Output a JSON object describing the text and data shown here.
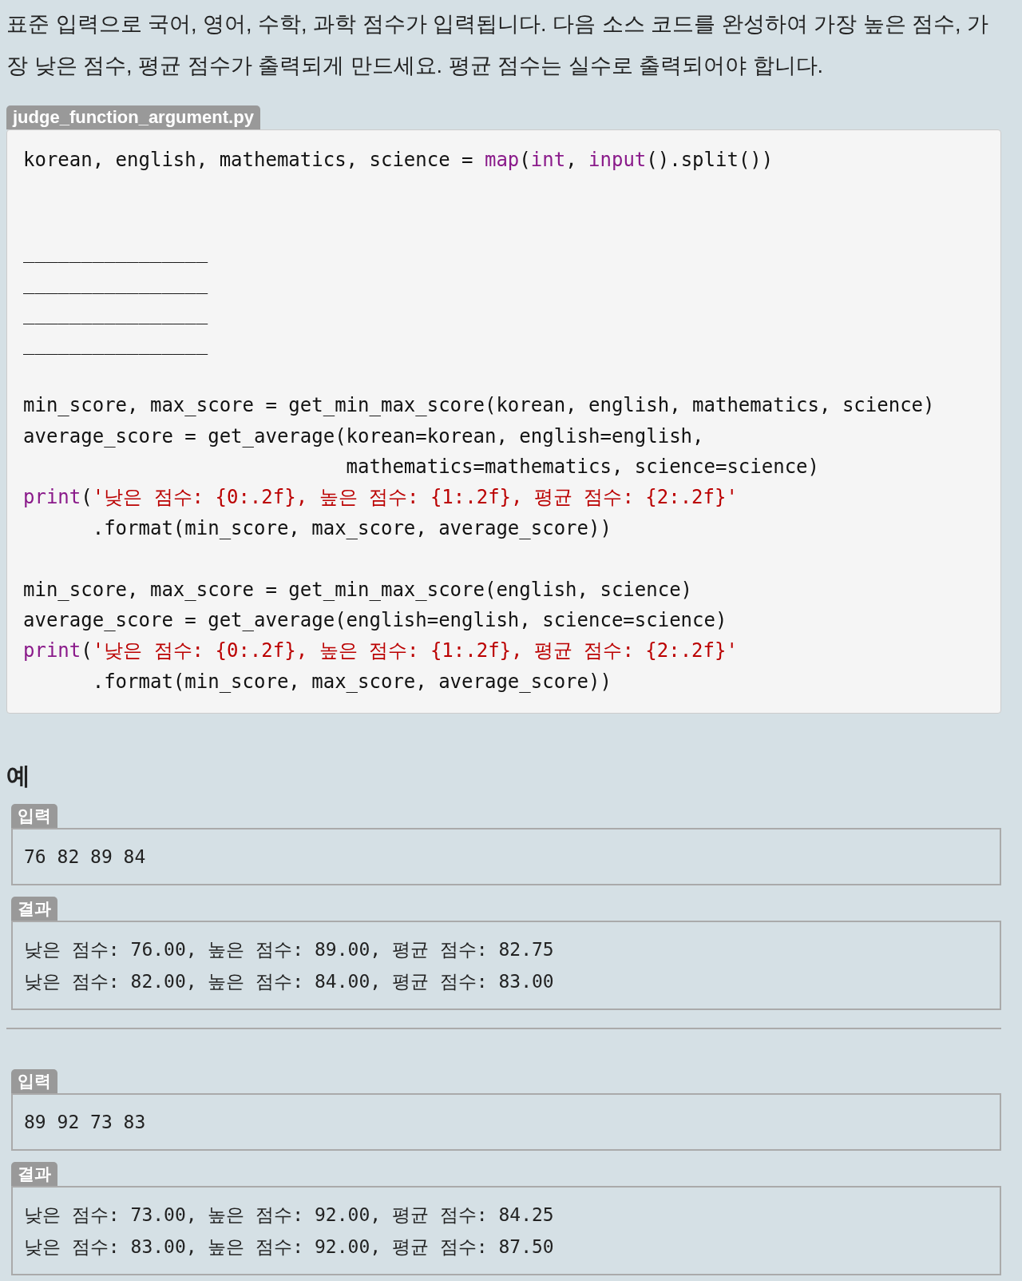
{
  "intro": "표준 입력으로 국어, 영어, 수학, 과학 점수가 입력됩니다. 다음 소스 코드를 완성하여 가장 높은 점수, 가장 낮은 점수, 평균 점수가 출력되게 만드세요. 평균 점수는 실수로 출력되어야 합니다.",
  "code_file": {
    "filename": "judge_function_argument.py",
    "lines": [
      {
        "kind": "code",
        "segments": [
          {
            "kind": "plain",
            "text": "korean, english, mathematics, science = "
          },
          {
            "kind": "builtin",
            "text": "map"
          },
          {
            "kind": "plain",
            "text": "("
          },
          {
            "kind": "builtin",
            "text": "int"
          },
          {
            "kind": "plain",
            "text": ", "
          },
          {
            "kind": "builtin",
            "text": "input"
          },
          {
            "kind": "plain",
            "text": "().split())"
          }
        ]
      },
      {
        "kind": "blank"
      },
      {
        "kind": "blank"
      },
      {
        "kind": "code",
        "segments": [
          {
            "kind": "plain",
            "text": "________________"
          }
        ]
      },
      {
        "kind": "code",
        "segments": [
          {
            "kind": "plain",
            "text": "________________"
          }
        ]
      },
      {
        "kind": "code",
        "segments": [
          {
            "kind": "plain",
            "text": "________________"
          }
        ]
      },
      {
        "kind": "code",
        "segments": [
          {
            "kind": "plain",
            "text": "________________"
          }
        ]
      },
      {
        "kind": "blank"
      },
      {
        "kind": "code",
        "segments": [
          {
            "kind": "plain",
            "text": "min_score, max_score = get_min_max_score(korean, english, mathematics, science)"
          }
        ]
      },
      {
        "kind": "code",
        "segments": [
          {
            "kind": "plain",
            "text": "average_score = get_average(korean=korean, english=english,"
          }
        ]
      },
      {
        "kind": "code",
        "segments": [
          {
            "kind": "plain",
            "text": "                            mathematics=mathematics, science=science)"
          }
        ]
      },
      {
        "kind": "code",
        "segments": [
          {
            "kind": "builtin",
            "text": "print"
          },
          {
            "kind": "plain",
            "text": "("
          },
          {
            "kind": "string",
            "text": "'낮은 점수: {0:.2f}, 높은 점수: {1:.2f}, 평균 점수: {2:.2f}'"
          }
        ]
      },
      {
        "kind": "code",
        "segments": [
          {
            "kind": "plain",
            "text": "      .format(min_score, max_score, average_score))"
          }
        ]
      },
      {
        "kind": "blank"
      },
      {
        "kind": "code",
        "segments": [
          {
            "kind": "plain",
            "text": "min_score, max_score = get_min_max_score(english, science)"
          }
        ]
      },
      {
        "kind": "code",
        "segments": [
          {
            "kind": "plain",
            "text": "average_score = get_average(english=english, science=science)"
          }
        ]
      },
      {
        "kind": "code",
        "segments": [
          {
            "kind": "builtin",
            "text": "print"
          },
          {
            "kind": "plain",
            "text": "("
          },
          {
            "kind": "string",
            "text": "'낮은 점수: {0:.2f}, 높은 점수: {1:.2f}, 평균 점수: {2:.2f}'"
          }
        ]
      },
      {
        "kind": "code",
        "segments": [
          {
            "kind": "plain",
            "text": "      .format(min_score, max_score, average_score))"
          }
        ]
      }
    ]
  },
  "examples": {
    "heading": "예",
    "cases": [
      {
        "input_label": "입력",
        "input": [
          "76 82 89 84"
        ],
        "result_label": "결과",
        "output": [
          "낮은 점수: 76.00, 높은 점수: 89.00, 평균 점수: 82.75",
          "낮은 점수: 82.00, 높은 점수: 84.00, 평균 점수: 83.00"
        ]
      },
      {
        "input_label": "입력",
        "input": [
          "89 92 73 83"
        ],
        "result_label": "결과",
        "output": [
          "낮은 점수: 73.00, 높은 점수: 92.00, 평균 점수: 84.25",
          "낮은 점수: 83.00, 높은 점수: 92.00, 평균 점수: 87.50"
        ]
      }
    ]
  }
}
